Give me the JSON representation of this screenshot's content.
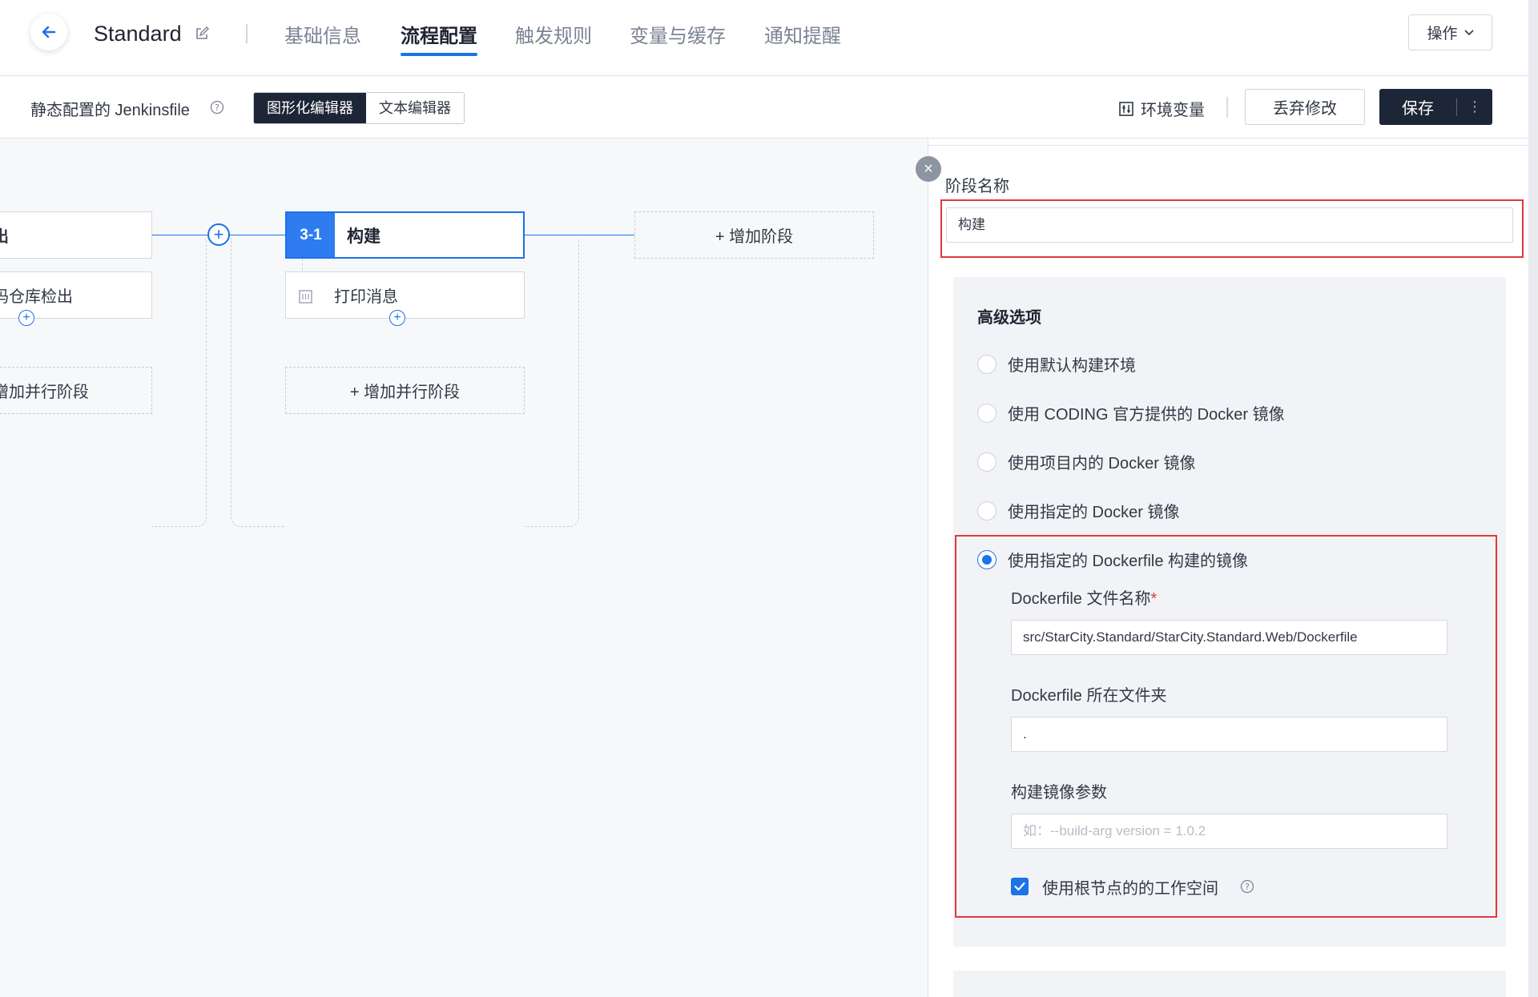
{
  "header": {
    "title": "Standard",
    "tabs": [
      {
        "label": "基础信息"
      },
      {
        "label": "流程配置"
      },
      {
        "label": "触发规则"
      },
      {
        "label": "变量与缓存"
      },
      {
        "label": "通知提醒"
      }
    ],
    "ops_label": "操作"
  },
  "toolbar": {
    "config_label": "静态配置的 Jenkinsfile",
    "editor_graphical": "图形化编辑器",
    "editor_text": "文本编辑器",
    "env_label": "环境变量",
    "discard_label": "丢弃修改",
    "save_label": "保存"
  },
  "canvas": {
    "left_stage_title": "出",
    "left_step": "码仓库检出",
    "left_parallel": "增加并行阶段",
    "stage_number": "3-1",
    "stage_name": "构建",
    "step_label": "打印消息",
    "add_parallel": "+ 增加并行阶段",
    "add_stage": "+ 增加阶段"
  },
  "panel": {
    "stage_name_label": "阶段名称",
    "stage_name_value": "构建",
    "advanced_title": "高级选项",
    "env_options": [
      {
        "label": "使用默认构建环境",
        "selected": false
      },
      {
        "label": "使用 CODING 官方提供的 Docker 镜像",
        "selected": false
      },
      {
        "label": "使用项目内的 Docker 镜像",
        "selected": false
      },
      {
        "label": "使用指定的 Docker 镜像",
        "selected": false
      },
      {
        "label": "使用指定的 Dockerfile 构建的镜像",
        "selected": true
      }
    ],
    "dockerfile_name_label": "Dockerfile 文件名称",
    "required_mark": "*",
    "dockerfile_name_value": "src/StarCity.Standard/StarCity.Standard.Web/Dockerfile",
    "dockerfile_dir_label": "Dockerfile 所在文件夹",
    "dockerfile_dir_value": ".",
    "build_args_label": "构建镜像参数",
    "build_args_placeholder": "如：--build-arg version = 1.0.2",
    "use_root_workspace_label": "使用根节点的的工作空间",
    "use_root_workspace_checked": true
  },
  "colors": {
    "accent": "#1a73e8",
    "dark": "#1d2637",
    "highlight_border": "#e0383e"
  }
}
